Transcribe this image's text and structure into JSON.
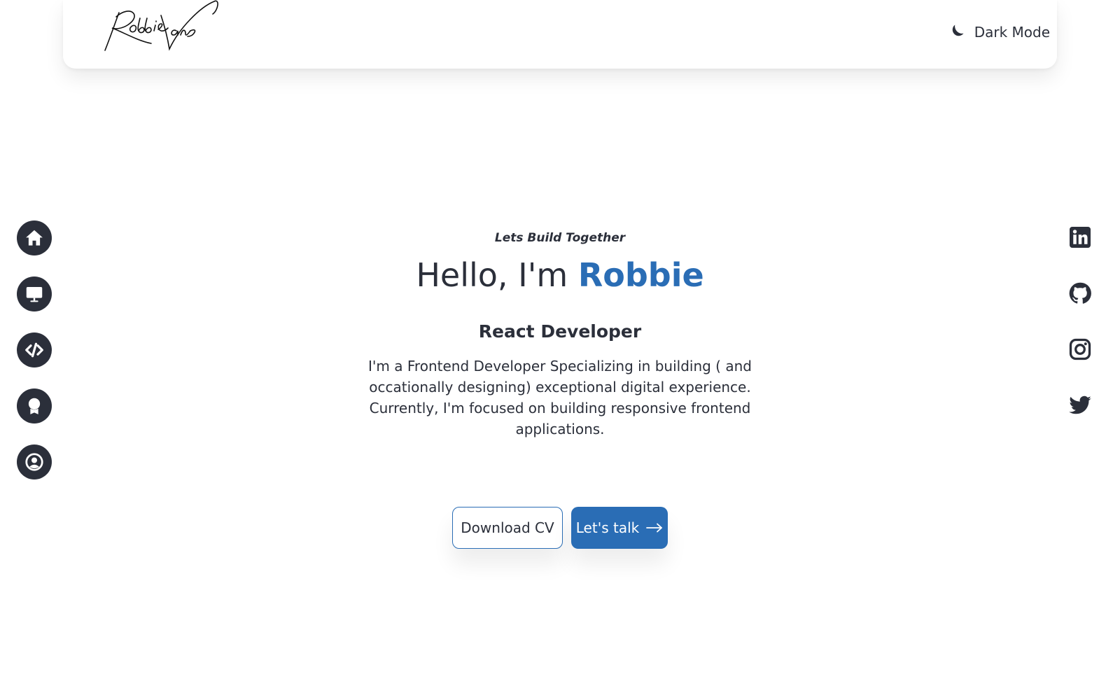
{
  "header": {
    "logo_alt": "Robbie Vans signature logo",
    "logo_icon": "signature-logo",
    "theme_toggle_label": "Dark Mode",
    "theme_toggle_icon": "moon-icon"
  },
  "side_nav": {
    "items": [
      {
        "name": "home",
        "icon": "home-icon"
      },
      {
        "name": "projects",
        "icon": "monitor-icon"
      },
      {
        "name": "skills",
        "icon": "code-icon"
      },
      {
        "name": "certifications",
        "icon": "award-icon"
      },
      {
        "name": "about",
        "icon": "user-icon"
      }
    ]
  },
  "socials": {
    "items": [
      {
        "name": "linkedin",
        "icon": "linkedin-icon"
      },
      {
        "name": "github",
        "icon": "github-icon"
      },
      {
        "name": "instagram",
        "icon": "instagram-icon"
      },
      {
        "name": "twitter",
        "icon": "twitter-icon"
      }
    ]
  },
  "hero": {
    "eyebrow": "Lets Build Together",
    "greeting": "Hello, I'm ",
    "name": "Robbie",
    "role": "React Developer",
    "bio": "I'm a Frontend Developer Specializing in building ( and occationally designing) exceptional digital experience. Currently, I'm focused on building responsive frontend applications.",
    "download_cv_label": "Download CV",
    "lets_talk_label": "Let's talk",
    "lets_talk_icon": "arrow-right-icon"
  },
  "colors": {
    "accent": "#2a6db5",
    "text": "#2b2f3a",
    "background": "#ffffff"
  }
}
